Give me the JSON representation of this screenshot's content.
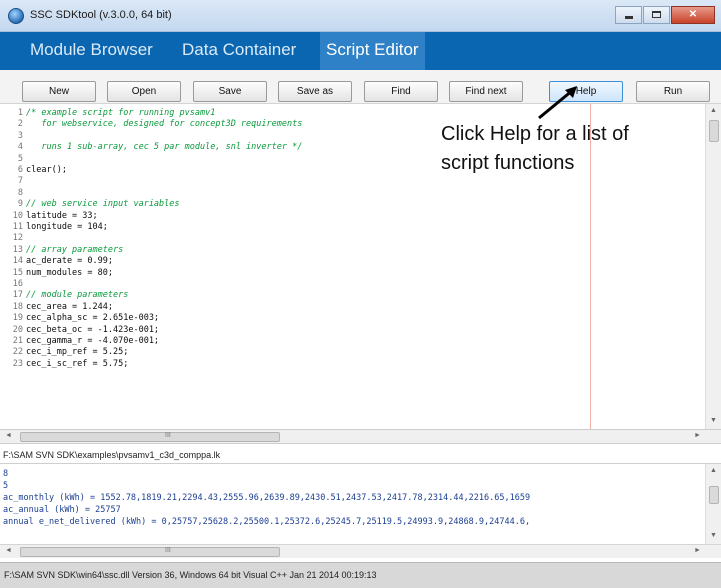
{
  "window": {
    "title": "SSC SDKtool (v.3.0.0, 64 bit)",
    "controls": {
      "minimize": "",
      "maximize": "",
      "close": "✕"
    }
  },
  "nav": {
    "tabs": [
      {
        "label": "Module Browser",
        "active": false
      },
      {
        "label": "Data Container",
        "active": false
      },
      {
        "label": "Script Editor",
        "active": true
      }
    ]
  },
  "toolbar": {
    "buttons": [
      "New",
      "Open",
      "Save",
      "Save as",
      "Find",
      "Find next",
      "Help",
      "Run"
    ]
  },
  "editor": {
    "lines": [
      {
        "n": "1",
        "text": "/* example script for running pvsamv1",
        "type": "comment"
      },
      {
        "n": "2",
        "text": "   for webservice, designed for concept3D requirements",
        "type": "comment"
      },
      {
        "n": "3",
        "text": "",
        "type": "comment"
      },
      {
        "n": "4",
        "text": "   runs 1 sub-array, cec 5 par module, snl inverter */",
        "type": "comment"
      },
      {
        "n": "5",
        "text": "",
        "type": "code"
      },
      {
        "n": "6",
        "text": "clear();",
        "type": "code"
      },
      {
        "n": "7",
        "text": "",
        "type": "code"
      },
      {
        "n": "8",
        "text": "",
        "type": "code"
      },
      {
        "n": "9",
        "text": "// web service input variables",
        "type": "comment"
      },
      {
        "n": "10",
        "text": "latitude = 33;",
        "type": "code"
      },
      {
        "n": "11",
        "text": "longitude = 104;",
        "type": "code"
      },
      {
        "n": "12",
        "text": "",
        "type": "code"
      },
      {
        "n": "13",
        "text": "// array parameters",
        "type": "comment"
      },
      {
        "n": "14",
        "text": "ac_derate = 0.99;",
        "type": "code"
      },
      {
        "n": "15",
        "text": "num_modules = 80;",
        "type": "code"
      },
      {
        "n": "16",
        "text": "",
        "type": "code"
      },
      {
        "n": "17",
        "text": "// module parameters",
        "type": "comment"
      },
      {
        "n": "18",
        "text": "cec_area = 1.244;",
        "type": "code"
      },
      {
        "n": "19",
        "text": "cec_alpha_sc = 2.651e-003;",
        "type": "code"
      },
      {
        "n": "20",
        "text": "cec_beta_oc = -1.423e-001;",
        "type": "code"
      },
      {
        "n": "21",
        "text": "cec_gamma_r = -4.070e-001;",
        "type": "code"
      },
      {
        "n": "22",
        "text": "cec_i_mp_ref = 5.25;",
        "type": "code"
      },
      {
        "n": "23",
        "text": "cec_i_sc_ref = 5.75;",
        "type": "code"
      }
    ]
  },
  "callout": {
    "text": "Click Help for a list of script functions"
  },
  "file_path": "F:\\SAM SVN SDK\\examples\\pvsamv1_c3d_comppa.lk",
  "output": {
    "lines": [
      "8",
      "5",
      "ac_monthly (kWh) = 1552.78,1819.21,2294.43,2555.96,2639.89,2430.51,2437.53,2417.78,2314.44,2216.65,1659",
      "ac_annual (kWh) = 25757",
      "annual e_net_delivered (kWh) = 0,25757,25628.2,25500.1,25372.6,25245.7,25119.5,24993.9,24868.9,24744.6,"
    ]
  },
  "status": "F:\\SAM SVN SDK\\win64\\ssc.dll Version 36, Windows 64 bit Visual C++ Jan 21 2014 00:19:13",
  "scroll": {
    "grip": "III",
    "up": "▲",
    "down": "▼",
    "left": "◄",
    "right": "►"
  }
}
